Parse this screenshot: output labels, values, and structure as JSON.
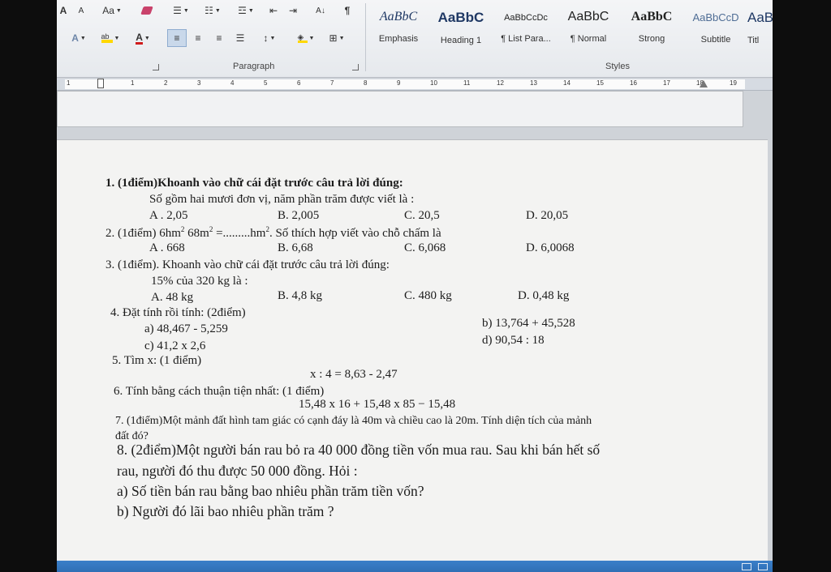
{
  "ribbon": {
    "font_row1": {
      "grow": "A",
      "shrink": "A",
      "case": "Aa"
    },
    "font_row2": {
      "text_effects": "A",
      "font_color": "A"
    },
    "para_sort": "A↓",
    "para_marks": "¶",
    "group_labels": {
      "paragraph": "Paragraph",
      "styles": "Styles"
    },
    "styles": [
      {
        "preview": "AaBbC",
        "name": "Emphasis",
        "italic": true
      },
      {
        "preview": "AaBbC",
        "name": "Heading 1",
        "bold": true
      },
      {
        "preview": "AaBbCcDc",
        "name": "¶ List Para..."
      },
      {
        "preview": "AaBbC",
        "name": "¶ Normal"
      },
      {
        "preview": "AaBbC",
        "name": "Strong",
        "bold": true
      },
      {
        "preview": "AaBbCcD",
        "name": "Subtitle"
      },
      {
        "preview": "AaB",
        "name": "Titl"
      }
    ]
  },
  "ruler": {
    "ticks": [
      "1",
      "1",
      "2",
      "3",
      "4",
      "5",
      "6",
      "7",
      "8",
      "9",
      "10",
      "11",
      "12",
      "13",
      "14",
      "15",
      "16",
      "17",
      "18",
      "19"
    ]
  },
  "doc": {
    "q1_title": "1. (1điểm)Khoanh vào chữ cái đặt trước câu trả lời đúng:",
    "q1_stem": "Số gồm hai mươi đơn vị, năm  phần trăm  được viết là :",
    "q1_a": "A . 2,05",
    "q1_b": "B. 2,005",
    "q1_c": "C. 20,5",
    "q1_d": "D. 20,05",
    "q2_pre": "2. (1điểm) 6hm",
    "q2_sup1": "2",
    "q2_mid": " 68m",
    "q2_sup2": "2",
    "q2_eq": " =.........",
    "q2_unit": "hm",
    "q2_sup3": "2",
    "q2_post": ". Số thích hợp viết vào chỗ chấm là",
    "q2_a": "A . 668",
    "q2_b": "B. 6,68",
    "q2_c": "C. 6,068",
    "q2_d": "D. 6,0068",
    "q3_title": "3. (1điểm). Khoanh vào chữ cái đặt trước câu trả lời đúng:",
    "q3_stem": "15% của 320 kg là :",
    "q3_a": "A. 48 kg",
    "q3_b": "B. 4,8 kg",
    "q3_c": "C. 480 kg",
    "q3_d": "D. 0,48 kg",
    "q4_title": "4. Đặt tính rồi tính: (2điểm)",
    "q4_a": "a)  48,467  -  5,259",
    "q4_b": "b)  13,764  + 45,528",
    "q4_c": "c) 41,2  x  2,6",
    "q4_d": "d) 90,54  :  18",
    "q5_title": "5. Tìm x: (1 điểm)",
    "q5_eq": "x  :  4  =  8,63 - 2,47",
    "q6_title": "6. Tính bằng cách thuận tiện nhất: (1 điểm)",
    "q6_eq": "15,48 x 16 + 15,48 x 85 − 15,48",
    "q7_line1": "7. (1điểm)Một mảnh đất hình tam giác có cạnh đáy là 40m và chiều cao là 20m. Tính diện tích của mảnh",
    "q7_line2": "đất đó?",
    "q8_line1": "8. (2điểm)Một người bán rau bỏ ra 40 000 đồng tiền vốn mua rau. Sau khi bán hết số",
    "q8_line2": "rau, người đó thu được 50 000 đồng. Hỏi :",
    "q8_a": "a) Số tiền bán rau bằng bao nhiêu phần trăm tiền vốn?",
    "q8_b": "b) Người đó lãi bao nhiêu phần trăm ?"
  },
  "colors": {
    "accent_blue": "#2f6fb5",
    "style_preview": "#1f3864"
  }
}
